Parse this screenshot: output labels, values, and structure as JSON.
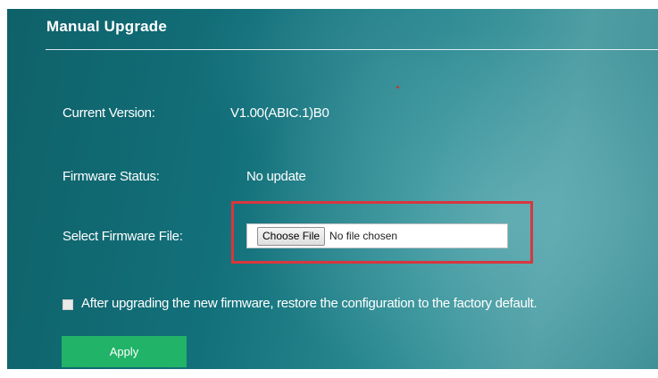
{
  "section": {
    "title": "Manual Upgrade"
  },
  "rows": {
    "current_version": {
      "label": "Current Version:",
      "value": "V1.00(ABIC.1)B0"
    },
    "firmware_status": {
      "label": "Firmware Status:",
      "value": "No update"
    },
    "select_file": {
      "label": "Select Firmware File:",
      "button_label": "Choose File",
      "status": "No file chosen"
    }
  },
  "restore_option": {
    "label": "After upgrading the new firmware, restore the configuration to the factory default.",
    "checked": false
  },
  "apply_label": "Apply",
  "colors": {
    "highlight": "#d9363e",
    "apply_button": "#21b368",
    "text": "#ffffff"
  }
}
